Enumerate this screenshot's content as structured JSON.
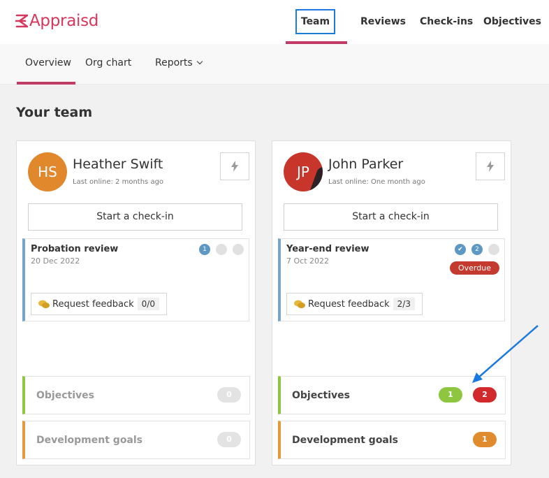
{
  "brand": {
    "name": "Appraisd",
    "color": "#d6385d"
  },
  "topnav": {
    "team": "Team",
    "reviews": "Reviews",
    "checkins": "Check-ins",
    "objectives": "Objectives"
  },
  "subnav": {
    "overview": "Overview",
    "orgchart": "Org chart",
    "reports": "Reports"
  },
  "page": {
    "title": "Your team"
  },
  "cards": [
    {
      "initials": "HS",
      "name": "Heather Swift",
      "last_online": "Last online: 2 months ago",
      "checkin_label": "Start a check-in",
      "review": {
        "title": "Probation review",
        "date": "20 Dec 2022",
        "steps": [
          "1",
          "",
          ""
        ],
        "feedback_label": "Request feedback",
        "feedback_count": "0/0"
      },
      "objectives": {
        "label": "Objectives",
        "count": "0"
      },
      "development": {
        "label": "Development goals",
        "count": "0"
      }
    },
    {
      "initials": "JP",
      "name": "John Parker",
      "last_online": "Last online: One month ago",
      "checkin_label": "Start a check-in",
      "review": {
        "title": "Year-end review",
        "date": "7 Oct 2022",
        "steps": [
          "✔",
          "2",
          ""
        ],
        "status": "Overdue",
        "feedback_label": "Request feedback",
        "feedback_count": "2/3"
      },
      "objectives": {
        "label": "Objectives",
        "count_green": "1",
        "count_red": "2"
      },
      "development": {
        "label": "Development goals",
        "count": "1"
      }
    }
  ]
}
